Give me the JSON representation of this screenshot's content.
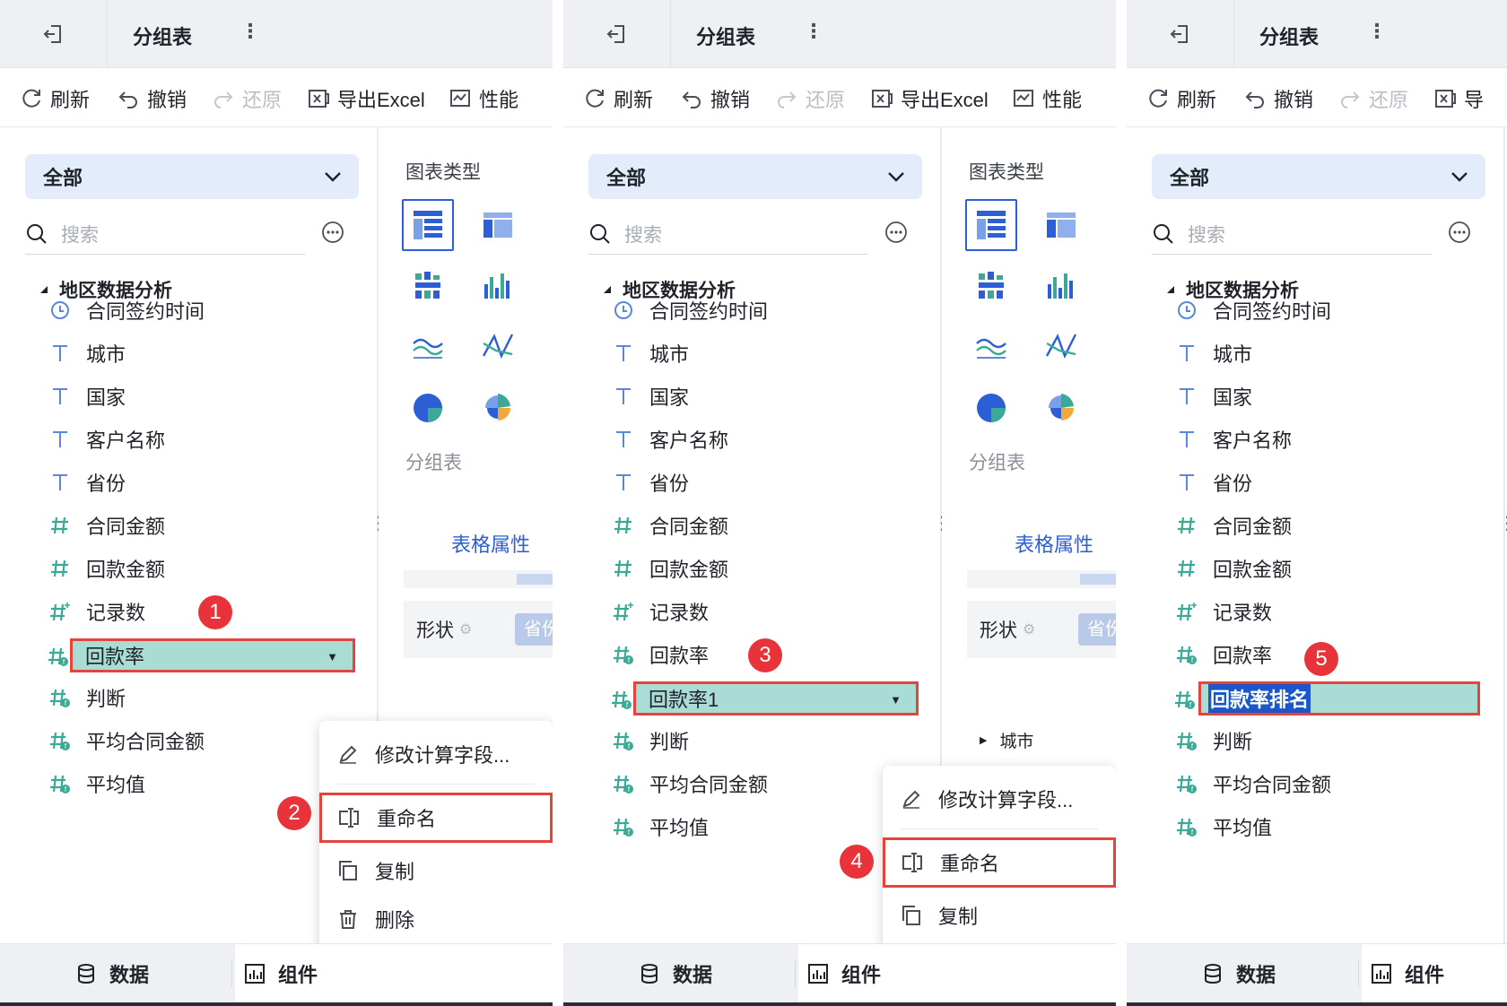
{
  "header": {
    "tab_title": "分组表",
    "more_label": "⋮"
  },
  "toolbar": {
    "refresh": "刷新",
    "undo": "撤销",
    "redo": "还原",
    "export": "导出Excel",
    "perf": "性能",
    "export_short": "导"
  },
  "sidebar": {
    "scope": "全部",
    "search_placeholder": "搜索",
    "group_name": "地区数据分析"
  },
  "fields": [
    {
      "label": "合同签约时间",
      "icon": "clock-icon"
    },
    {
      "label": "城市",
      "icon": "text-type-icon"
    },
    {
      "label": "国家",
      "icon": "text-type-icon"
    },
    {
      "label": "客户名称",
      "icon": "text-type-icon"
    },
    {
      "label": "省份",
      "icon": "text-type-icon"
    },
    {
      "label": "合同金额",
      "icon": "number-type-icon"
    },
    {
      "label": "回款金额",
      "icon": "number-type-icon"
    },
    {
      "label": "记录数",
      "icon": "count-type-icon"
    },
    {
      "label": "回款率",
      "icon": "calc-field-icon"
    },
    {
      "label": "回款率1",
      "icon": "calc-field-icon"
    },
    {
      "label": "判断",
      "icon": "calc-field-icon"
    },
    {
      "label": "平均合同金额",
      "icon": "calc-field-icon"
    },
    {
      "label": "平均值",
      "icon": "calc-field-icon"
    },
    {
      "label": "回款率排名",
      "icon": "calc-field-icon"
    }
  ],
  "context_menu": {
    "edit": "修改计算字段...",
    "rename": "重命名",
    "copy": "复制",
    "delete": "删除"
  },
  "chart_panel": {
    "label": "图表类型",
    "current": "分组表",
    "attr_tab": "表格属性",
    "shape_label": "形状",
    "shape_chip": "省份",
    "city_row": "城市"
  },
  "bottom": {
    "data_tab": "数据",
    "component_tab": "组件"
  },
  "steps": [
    "1",
    "2",
    "3",
    "4",
    "5"
  ],
  "colors": {
    "selected_bg": "#a8dcd4",
    "highlight_border": "#e5443d",
    "badge_red": "#e8333a",
    "accent_blue": "#2c5fd6",
    "field_icon_green": "#3aaa97"
  }
}
